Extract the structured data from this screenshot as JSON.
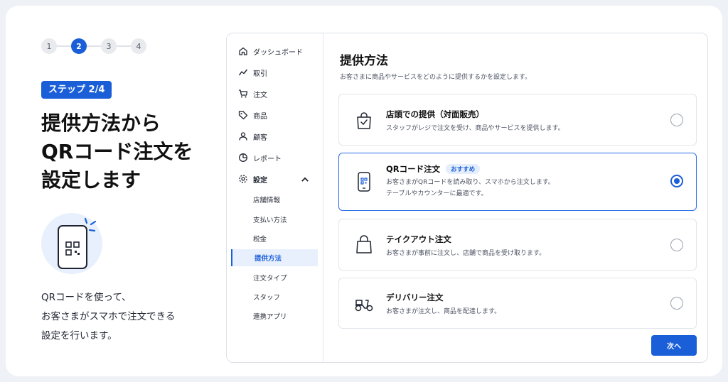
{
  "stepper": {
    "steps": [
      "1",
      "2",
      "3",
      "4"
    ],
    "current": 2
  },
  "step_badge": "ステップ 2/4",
  "headline": [
    "提供方法から",
    "QRコード注文を",
    "設定します"
  ],
  "description": [
    "QRコードを使って、",
    "お客さまがスマホで注文できる",
    "設定を行います。"
  ],
  "sidebar": {
    "items": [
      {
        "label": "ダッシュボード",
        "icon": "home-icon"
      },
      {
        "label": "取引",
        "icon": "chart-line-icon"
      },
      {
        "label": "注文",
        "icon": "cart-icon"
      },
      {
        "label": "商品",
        "icon": "tag-icon"
      },
      {
        "label": "顧客",
        "icon": "user-icon"
      },
      {
        "label": "レポート",
        "icon": "pie-chart-icon"
      },
      {
        "label": "設定",
        "icon": "gear-icon",
        "expanded": true
      }
    ],
    "sub_items": [
      "店舗情報",
      "支払い方法",
      "税金",
      "提供方法",
      "注文タイプ",
      "スタッフ",
      "連携アプリ"
    ],
    "active_sub": "提供方法"
  },
  "main": {
    "title": "提供方法",
    "subtitle": "お客さまに商品やサービスをどのように提供するかを設定します。",
    "options": [
      {
        "title": "店頭での提供（対面販売）",
        "desc": [
          "スタッフがレジで注文を受け、商品やサービスを提供します。"
        ],
        "icon": "shopping-bag-check-icon",
        "selected": false
      },
      {
        "title": "QRコード注文",
        "badge": "おすすめ",
        "desc": [
          "お客さまがQRコードを読み取り、スマホから注文します。",
          "テーブルやカウンターに最適です。"
        ],
        "icon": "phone-qr-icon",
        "selected": true
      },
      {
        "title": "テイクアウト注文",
        "desc": [
          "お客さまが事前に注文し、店舗で商品を受け取ります。"
        ],
        "icon": "takeout-bag-icon",
        "selected": false
      },
      {
        "title": "デリバリー注文",
        "desc": [
          "お客さまが注文し、商品を配達します。"
        ],
        "icon": "scooter-icon",
        "selected": false
      }
    ],
    "next_label": "次へ"
  },
  "colors": {
    "accent": "#1a5fd8",
    "background": "#eef1f6"
  }
}
